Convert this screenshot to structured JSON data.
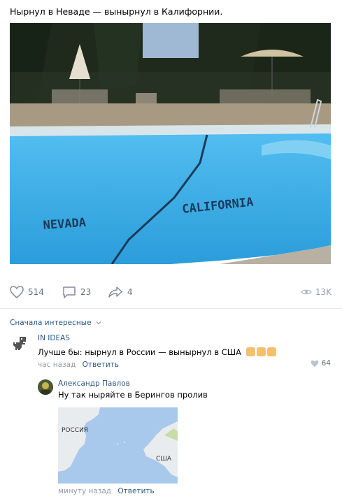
{
  "post": {
    "text": "Нырнул в Неваде — вынырнул в Калифорнии.",
    "photo": {
      "left_label": "NEVADA",
      "right_label": "CALIFORNIA"
    },
    "likes": "514",
    "comments": "23",
    "shares": "4",
    "views": "13K"
  },
  "comments": {
    "sort_label": "Сначала интересные",
    "items": [
      {
        "author": "IN IDEAS",
        "text": "Лучше бы: нырнул в России — вынырнул в США",
        "time": "час назад",
        "reply_label": "Ответить",
        "likes": "64"
      },
      {
        "author": "Александр Павлов",
        "text": "Ну так ныряйте в Берингов пролив",
        "time": "минуту назад",
        "reply_label": "Ответить",
        "map": {
          "left_label": "РОССИЯ",
          "right_label": "США"
        }
      }
    ]
  },
  "colors": {
    "link": "#2a5885",
    "muted": "#939aa3",
    "pool": "#3aa8e0"
  }
}
